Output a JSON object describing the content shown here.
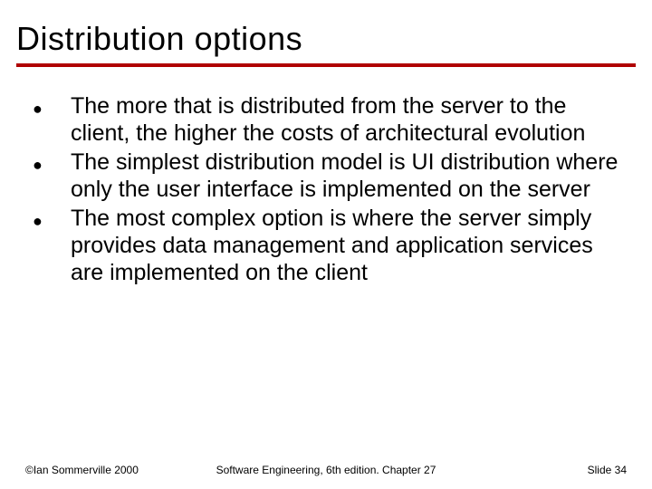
{
  "title": "Distribution options",
  "bullets": [
    "The more that is distributed from the server to the client, the higher the costs of architectural evolution",
    "The simplest distribution model is UI distribution where only the user interface is implemented on the server",
    "The most complex option is where the server simply provides data management and application services are implemented on the client"
  ],
  "footer": {
    "left": "©Ian Sommerville 2000",
    "center": "Software Engineering, 6th edition. Chapter 27",
    "right": "Slide 34"
  },
  "glyphs": {
    "bullet": "●"
  }
}
